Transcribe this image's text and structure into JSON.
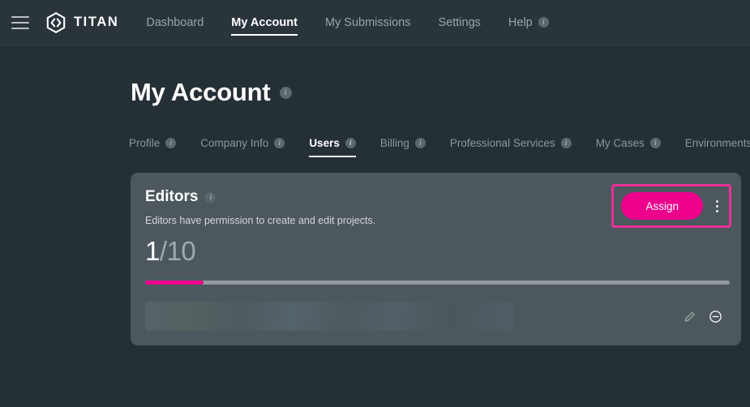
{
  "navbar": {
    "menu_icon": "hamburger-icon",
    "brand": {
      "logo_icon": "titan-hexagon-logo-icon",
      "name": "TITAN"
    },
    "links": [
      {
        "label": "Dashboard",
        "active": false,
        "info": false
      },
      {
        "label": "My Account",
        "active": true,
        "info": false
      },
      {
        "label": "My Submissions",
        "active": false,
        "info": false
      },
      {
        "label": "Settings",
        "active": false,
        "info": false
      },
      {
        "label": "Help",
        "active": false,
        "info": true
      }
    ],
    "info_glyph": "i"
  },
  "page": {
    "title": "My Account",
    "title_info": "i"
  },
  "tabs": [
    {
      "label": "Profile",
      "active": false
    },
    {
      "label": "Company Info",
      "active": false
    },
    {
      "label": "Users",
      "active": true
    },
    {
      "label": "Billing",
      "active": false
    },
    {
      "label": "Professional Services",
      "active": false
    },
    {
      "label": "My Cases",
      "active": false
    },
    {
      "label": "Environments",
      "active": false
    }
  ],
  "card": {
    "title": "Editors",
    "title_info": "i",
    "subtitle": "Editors have permission to create and edit projects.",
    "assign_label": "Assign",
    "kebab_icon": "more-vertical-icon",
    "highlight_color": "#f0309b",
    "accent_color": "#ec008c",
    "counter": {
      "used": "1",
      "total": "/10"
    },
    "progress": {
      "percent": 10,
      "fill_color": "#ec008c",
      "track_color": "#90999c"
    },
    "member_row": {
      "state": "loading-skeleton",
      "edit_icon": "pencil-icon",
      "remove_icon": "minus-circle-icon"
    }
  }
}
